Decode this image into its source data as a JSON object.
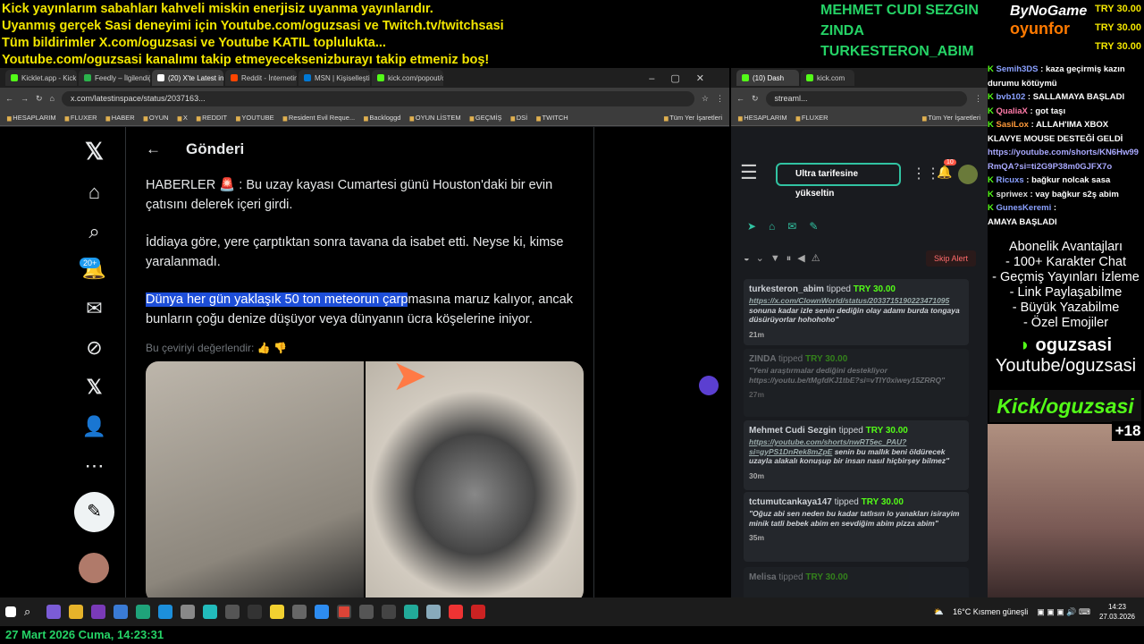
{
  "ticker": [
    "Kick yayınlarım sabahları kahveli miskin enerjisiz uyanma yayınlarıdır.",
    "Uyanmış gerçek Sasi deneyimi için Youtube.com/oguzsasi ve Twitch.tv/twitchsasi",
    "Tüm bildirimler X.com/oguzsasi ve Youtube KATIL toplulukta...",
    "Youtube.com/oguzsasi kanalımı takip etmeyeceksenizburayı takip etmeniz boş!"
  ],
  "streamer_names": [
    "MEHMET CUDI SEZGIN",
    "ZINDA",
    "TURKESTERON_ABIM"
  ],
  "logo": {
    "line1": "ByNoGame",
    "line2": "oyunfor"
  },
  "top_tips": [
    "TRY 30.00",
    "TRY 30.00",
    "TRY 30.00"
  ],
  "browser1": {
    "tabs": [
      "Kicklet.app - Kick Cha",
      "Feedly – İlgilendiğiniz",
      "(20) X'te Latest in spa",
      "Reddit - İnternetin kal",
      "MSN | Kişiselleştirilmiş",
      "kick.com/popout/oguz"
    ],
    "url": "x.com/latestinspace/status/2037163...",
    "bookmarks": [
      "HESAPLARIM",
      "FLUXER",
      "HABER",
      "OYUN",
      "X",
      "REDDIT",
      "YOUTUBE",
      "Resident Evil Reque...",
      "Backloggd",
      "OYUN LİSTEM",
      "GEÇMİŞ",
      "DSİ",
      "TWITCH",
      "Tüm Yer İşaretleri"
    ]
  },
  "xpage": {
    "header": "Gönderi",
    "badge": "20+",
    "p1": "HABERLER 🚨 : Bu uzay kayası Cumartesi günü Houston'daki bir evin çatısını delerek içeri girdi.",
    "p2": "İddiaya göre, yere çarptıktan sonra tavana da isabet etti. Neyse ki, kimse yaralanmadı.",
    "p3_hl": "Dünya her gün yaklaşık 50 ton meteorun çarp",
    "p3_rest": "masına maruz kalıyor, ancak bunların çoğu denize düşüyor veya dünyanın ücra köşelerine iniyor.",
    "rate": "Bu çeviriyi değerlendir:"
  },
  "browser2": {
    "tabs": [
      "(10) Dash",
      "kick.com"
    ],
    "url": "streaml...",
    "bookmarks": [
      "HESAPLARIM",
      "FLUXER",
      "Tüm Yer İşaretleri"
    ],
    "upgrade": "Ultra tarifesine yükseltin",
    "notif": "10",
    "skip": "Skip Alert",
    "tips": [
      {
        "who": "turkesteron_abim",
        "verb": "tipped",
        "amt": "TRY 30.00",
        "link": "https://x.com/ClownWorld/status/2033715190223471095",
        "msg": "sonuna kadar izle senin dediğin olay adamı burda tongaya düsürüyorlar hohohoho\"",
        "time": "21m"
      },
      {
        "who": "ZINDA",
        "verb": "tipped",
        "amt": "TRY 30.00",
        "link": "",
        "msg": "\"Yeni araştırmalar dediğini destekliyor https://youtu.be/tMgfdKJ1tbE?si=vTIY0xiwey15ZRRQ\"",
        "time": "27m"
      },
      {
        "who": "Mehmet Cudi Sezgin",
        "verb": "tipped",
        "amt": "TRY 30.00",
        "link": "https://youtube.com/shorts/nwRT5ec_PAU?si=gyPS1DnRek8mZpE",
        "msg": "senin bu mallık beni öldürecek uzayla alakalı konuşup bir insan nasıl hiçbirşey bilmez\"",
        "time": "30m"
      },
      {
        "who": "tctumutcankaya147",
        "verb": "tipped",
        "amt": "TRY 30.00",
        "link": "",
        "msg": "\"Oğuz abi sen neden bu kadar tatlısın lo yanakları isirayim minik tatli bebek abim en sevdiğim abim pizza abim\"",
        "time": "35m"
      },
      {
        "who": "Melisa",
        "verb": "tipped",
        "amt": "TRY 30.00",
        "link": "",
        "msg": "",
        "time": ""
      }
    ]
  },
  "chat": [
    {
      "name": "Semih3DS",
      "text": ": kaza geçirmiş kazın durumu kötüymü"
    },
    {
      "name": "bvb102",
      "text": ": SALLAMAYA BAŞLADI"
    },
    {
      "name": "QualiaX",
      "text": ": got taşı"
    },
    {
      "name": "SasiLox",
      "text": ": ALLAH'IMA XBOX KLAVYE MOUSE DESTEĞİ GELDİ"
    },
    {
      "name": "",
      "text": "https://youtube.com/shorts/KN6Hw99RmQA?si=ti2G9P38m0GJFX7o"
    },
    {
      "name": "Ricuxs",
      "text": ": bağkur nolcak sasa"
    },
    {
      "name": "spriwex",
      "text": ": vay bağkur s2ş abim"
    },
    {
      "name": "GunesKeremi",
      "text": ":"
    },
    {
      "name": "",
      "text": "AMAYA BAŞLADI"
    }
  ],
  "perks": [
    "Abonelik Avantajları",
    "- 100+ Karakter Chat",
    "- Geçmiş Yayınları İzleme",
    "- Link Paylaşabilme",
    "- Büyük Yazabilme",
    "- Özel Emojiler"
  ],
  "handle": {
    "name": "oguzsasi",
    "yt": "Youtube/oguzsasi",
    "kick": "Kick/oguzsasi",
    "age": "+18"
  },
  "tray": {
    "weather": "16°C  Kısmen güneşli",
    "time": "14:23",
    "date": "27.03.2026"
  },
  "datebar": "27 Mart 2026 Cuma, 14:23:31"
}
